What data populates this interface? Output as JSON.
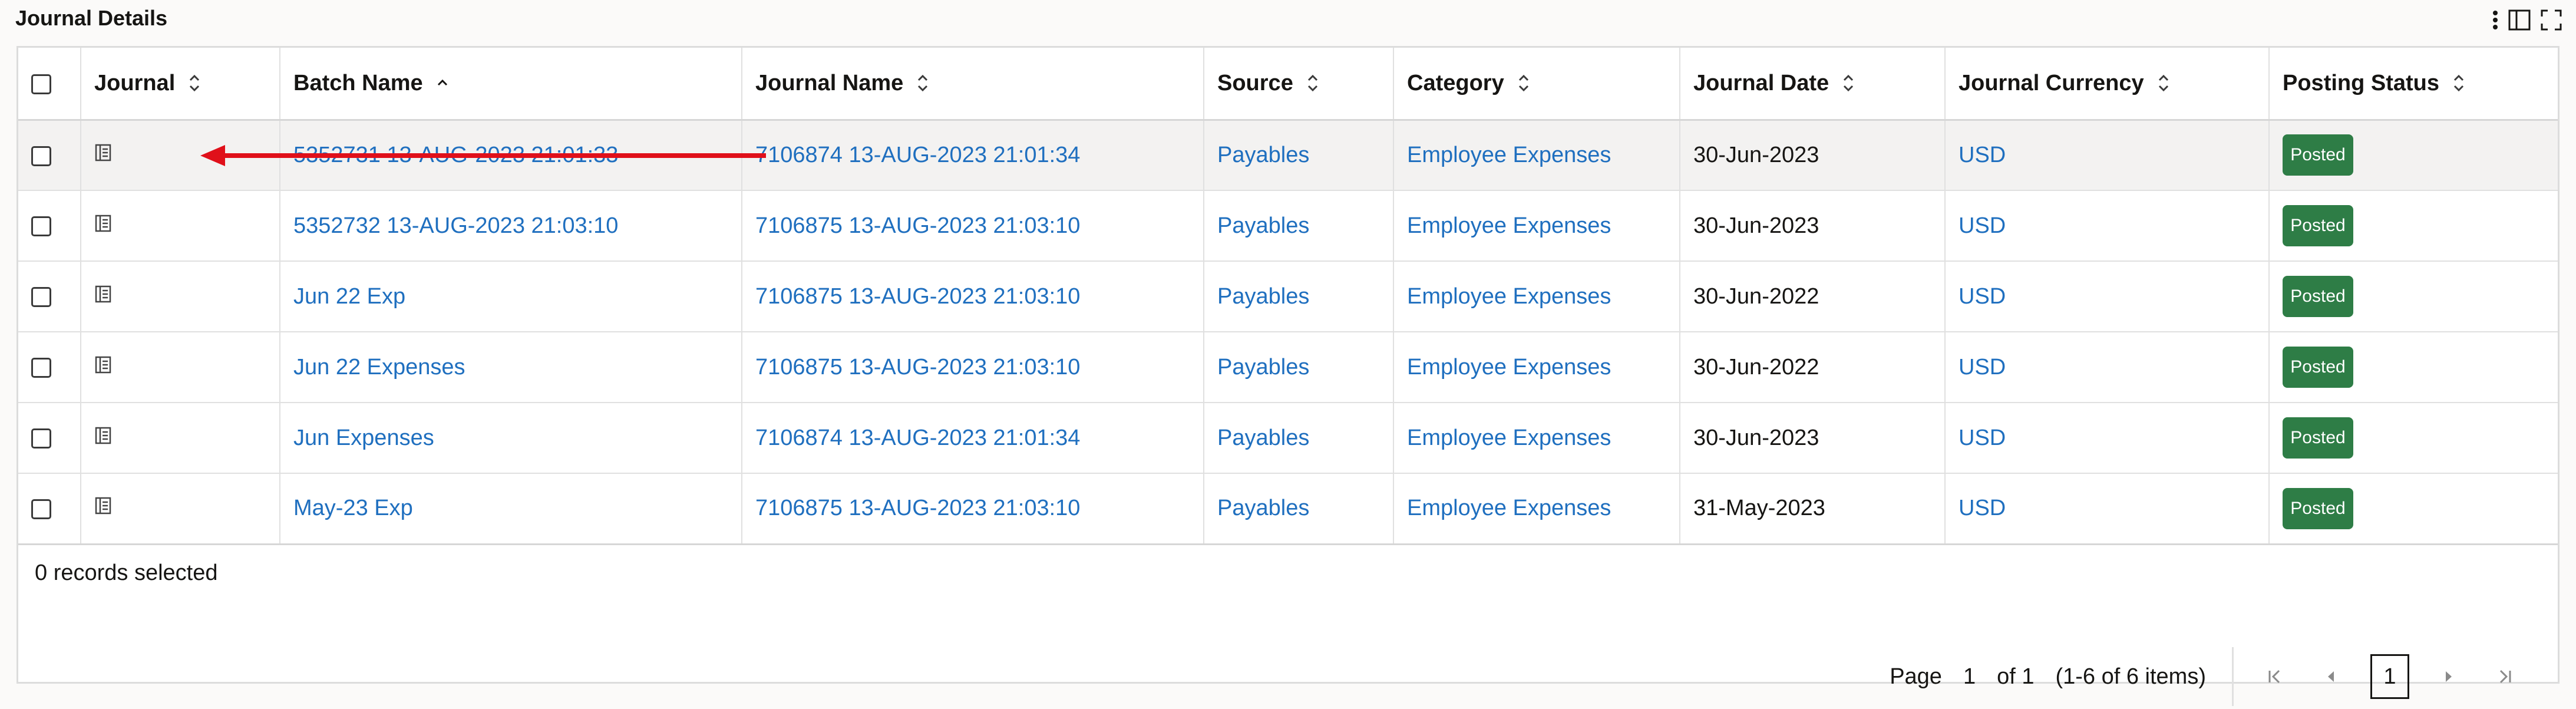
{
  "panel": {
    "title": "Journal Details",
    "tools": [
      "more-vertical-icon",
      "columns-icon",
      "fullscreen-icon"
    ]
  },
  "table": {
    "columns": [
      "Journal",
      "Batch Name",
      "Journal Name",
      "Source",
      "Category",
      "Journal Date",
      "Journal Currency",
      "Posting Status"
    ],
    "sort": {
      "batch_name": "ascending"
    },
    "rows": [
      {
        "batch": "5352731 13-AUG-2023 21:01:33",
        "journal_name": "7106874 13-AUG-2023 21:01:34",
        "source": "Payables",
        "category": "Employee Expenses",
        "date": "30-Jun-2023",
        "currency": "USD",
        "status": "Posted"
      },
      {
        "batch": "5352732 13-AUG-2023 21:03:10",
        "journal_name": "7106875 13-AUG-2023 21:03:10",
        "source": "Payables",
        "category": "Employee Expenses",
        "date": "30-Jun-2023",
        "currency": "USD",
        "status": "Posted"
      },
      {
        "batch": "Jun 22 Exp",
        "journal_name": "7106875 13-AUG-2023 21:03:10",
        "source": "Payables",
        "category": "Employee Expenses",
        "date": "30-Jun-2022",
        "currency": "USD",
        "status": "Posted"
      },
      {
        "batch": "Jun 22 Expenses",
        "journal_name": "7106875 13-AUG-2023 21:03:10",
        "source": "Payables",
        "category": "Employee Expenses",
        "date": "30-Jun-2022",
        "currency": "USD",
        "status": "Posted"
      },
      {
        "batch": "Jun Expenses",
        "journal_name": "7106874 13-AUG-2023 21:01:34",
        "source": "Payables",
        "category": "Employee Expenses",
        "date": "30-Jun-2023",
        "currency": "USD",
        "status": "Posted"
      },
      {
        "batch": "May-23 Exp",
        "journal_name": "7106875 13-AUG-2023 21:03:10",
        "source": "Payables",
        "category": "Employee Expenses",
        "date": "31-May-2023",
        "currency": "USD",
        "status": "Posted"
      }
    ]
  },
  "footer": {
    "selected": "0 records selected"
  },
  "pagination": {
    "page_label": "Page",
    "page_value": "1",
    "of_label": "of 1",
    "items_label": "(1-6 of 6 items)",
    "current_page": "1"
  },
  "colors": {
    "link": "#1f6fbf",
    "posted_badge": "#2e7d46",
    "annotation_arrow": "#e0101a"
  }
}
